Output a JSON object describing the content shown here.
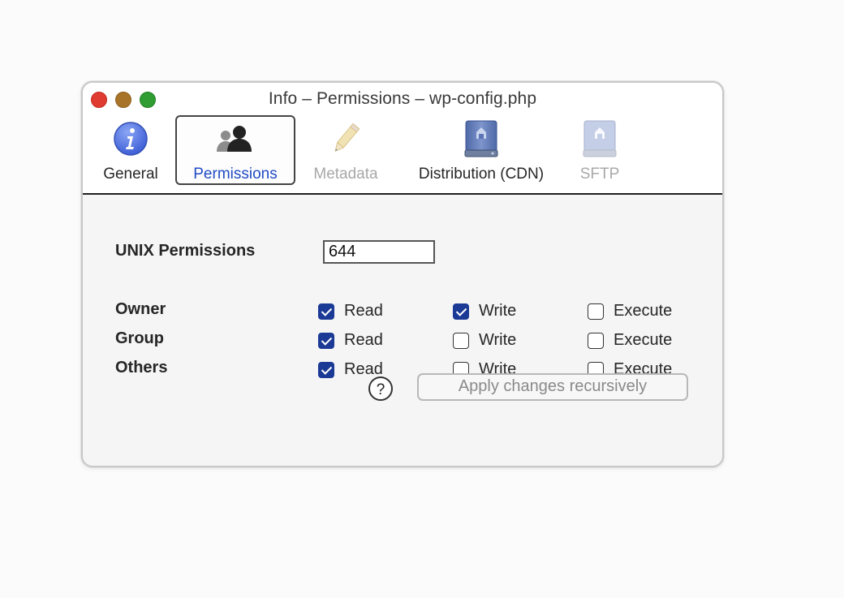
{
  "window": {
    "title": "Info – Permissions – wp-config.php"
  },
  "tabs": [
    {
      "label": "General",
      "icon": "info-icon",
      "state": "normal"
    },
    {
      "label": "Permissions",
      "icon": "users-icon",
      "state": "selected"
    },
    {
      "label": "Metadata",
      "icon": "pencil-icon",
      "state": "disabled"
    },
    {
      "label": "Distribution (CDN)",
      "icon": "drive-icon",
      "state": "normal"
    },
    {
      "label": "SFTP",
      "icon": "drive-icon",
      "state": "disabled"
    }
  ],
  "unix": {
    "label": "UNIX Permissions",
    "value": "644"
  },
  "permissions": [
    {
      "label": "Owner",
      "read": true,
      "write": true,
      "execute": false
    },
    {
      "label": "Group",
      "read": true,
      "write": false,
      "execute": false
    },
    {
      "label": "Others",
      "read": true,
      "write": false,
      "execute": false
    }
  ],
  "labels": {
    "read": "Read",
    "write": "Write",
    "execute": "Execute"
  },
  "help_label": "?",
  "apply_label": "Apply changes recursively",
  "colors": {
    "selected_tab_text": "#1f4bc4",
    "checkbox_checked": "#1b3a96"
  }
}
